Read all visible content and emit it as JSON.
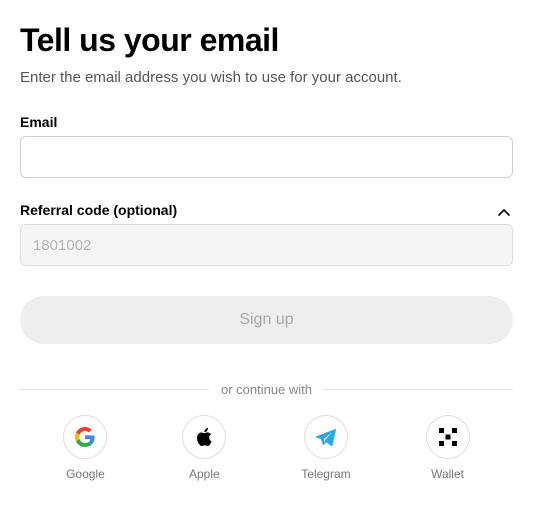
{
  "heading": "Tell us your email",
  "subtitle": "Enter the email address you wish to use for your account.",
  "email": {
    "label": "Email",
    "value": ""
  },
  "referral": {
    "label": "Referral code (optional)",
    "value": "1801002"
  },
  "signup_label": "Sign up",
  "divider_text": "or continue with",
  "providers": {
    "google": "Google",
    "apple": "Apple",
    "telegram": "Telegram",
    "wallet": "Wallet"
  }
}
